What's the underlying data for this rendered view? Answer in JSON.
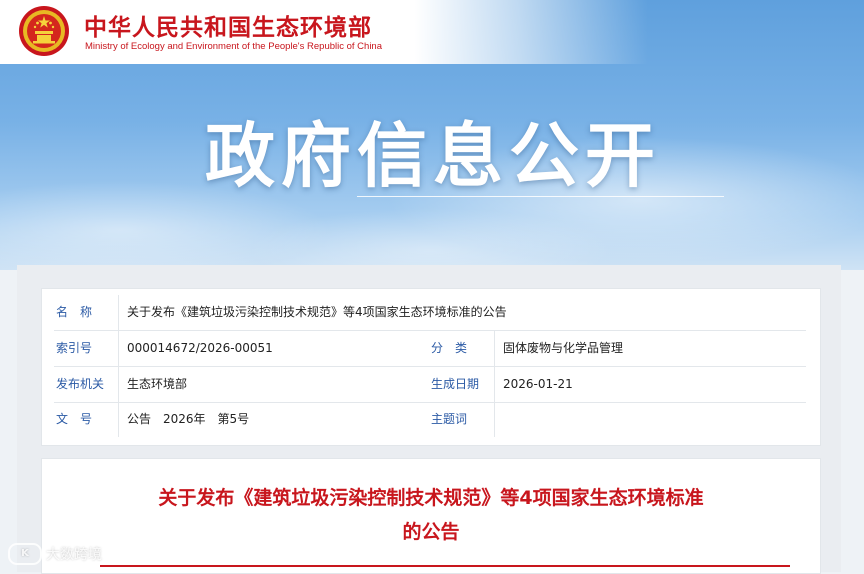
{
  "header": {
    "site_title_cn": "中华人民共和国生态环境部",
    "site_title_en": "Ministry of Ecology and Environment of the People's Republic of China",
    "emblem_icon": "national-emblem-icon"
  },
  "hero": {
    "title": "政府信息公开"
  },
  "info": {
    "name_label": "名　称",
    "name_value": "关于发布《建筑垃圾污染控制技术规范》等4项国家生态环境标准的公告",
    "index_label": "索引号",
    "index_value": "000014672/2026-00051",
    "category_label": "分　类",
    "category_value": "固体废物与化学品管理",
    "issuer_label": "发布机关",
    "issuer_value": "生态环境部",
    "date_label": "生成日期",
    "date_value": "2026-01-21",
    "docno_label": "文　号",
    "docno_value": "公告　2026年　第5号",
    "subject_label": "主题词",
    "subject_value": ""
  },
  "article": {
    "title_line1": "关于发布《建筑垃圾污染控制技术规范》等4项国家生态环境标准",
    "title_line2": "的公告"
  },
  "watermark": {
    "text": "大数跨境",
    "logo_text": "K"
  },
  "colors": {
    "brand_red": "#c8161d",
    "label_blue": "#2b5aa5"
  }
}
